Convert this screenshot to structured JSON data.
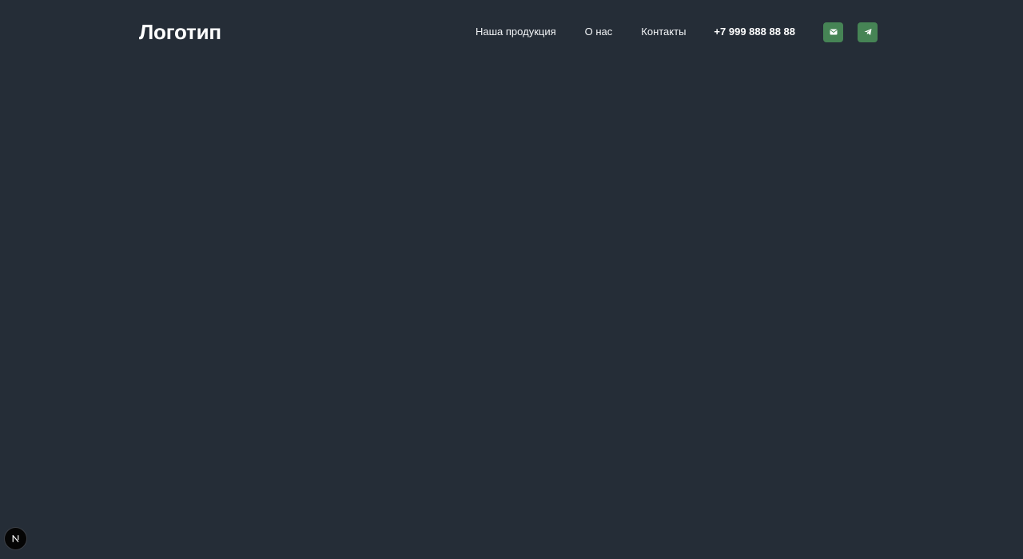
{
  "header": {
    "logo": "Логотип",
    "nav": {
      "products": "Наша продукция",
      "about": "О нас",
      "contacts": "Контакты"
    },
    "phone": "+7 999 888 88 88",
    "icons": {
      "mail": "mail-icon",
      "telegram": "telegram-icon"
    }
  },
  "dev_badge": {
    "icon": "nextjs-icon",
    "letter": "N"
  },
  "colors": {
    "background": "#252d37",
    "accent": "#468455",
    "text": "#ffffff"
  }
}
